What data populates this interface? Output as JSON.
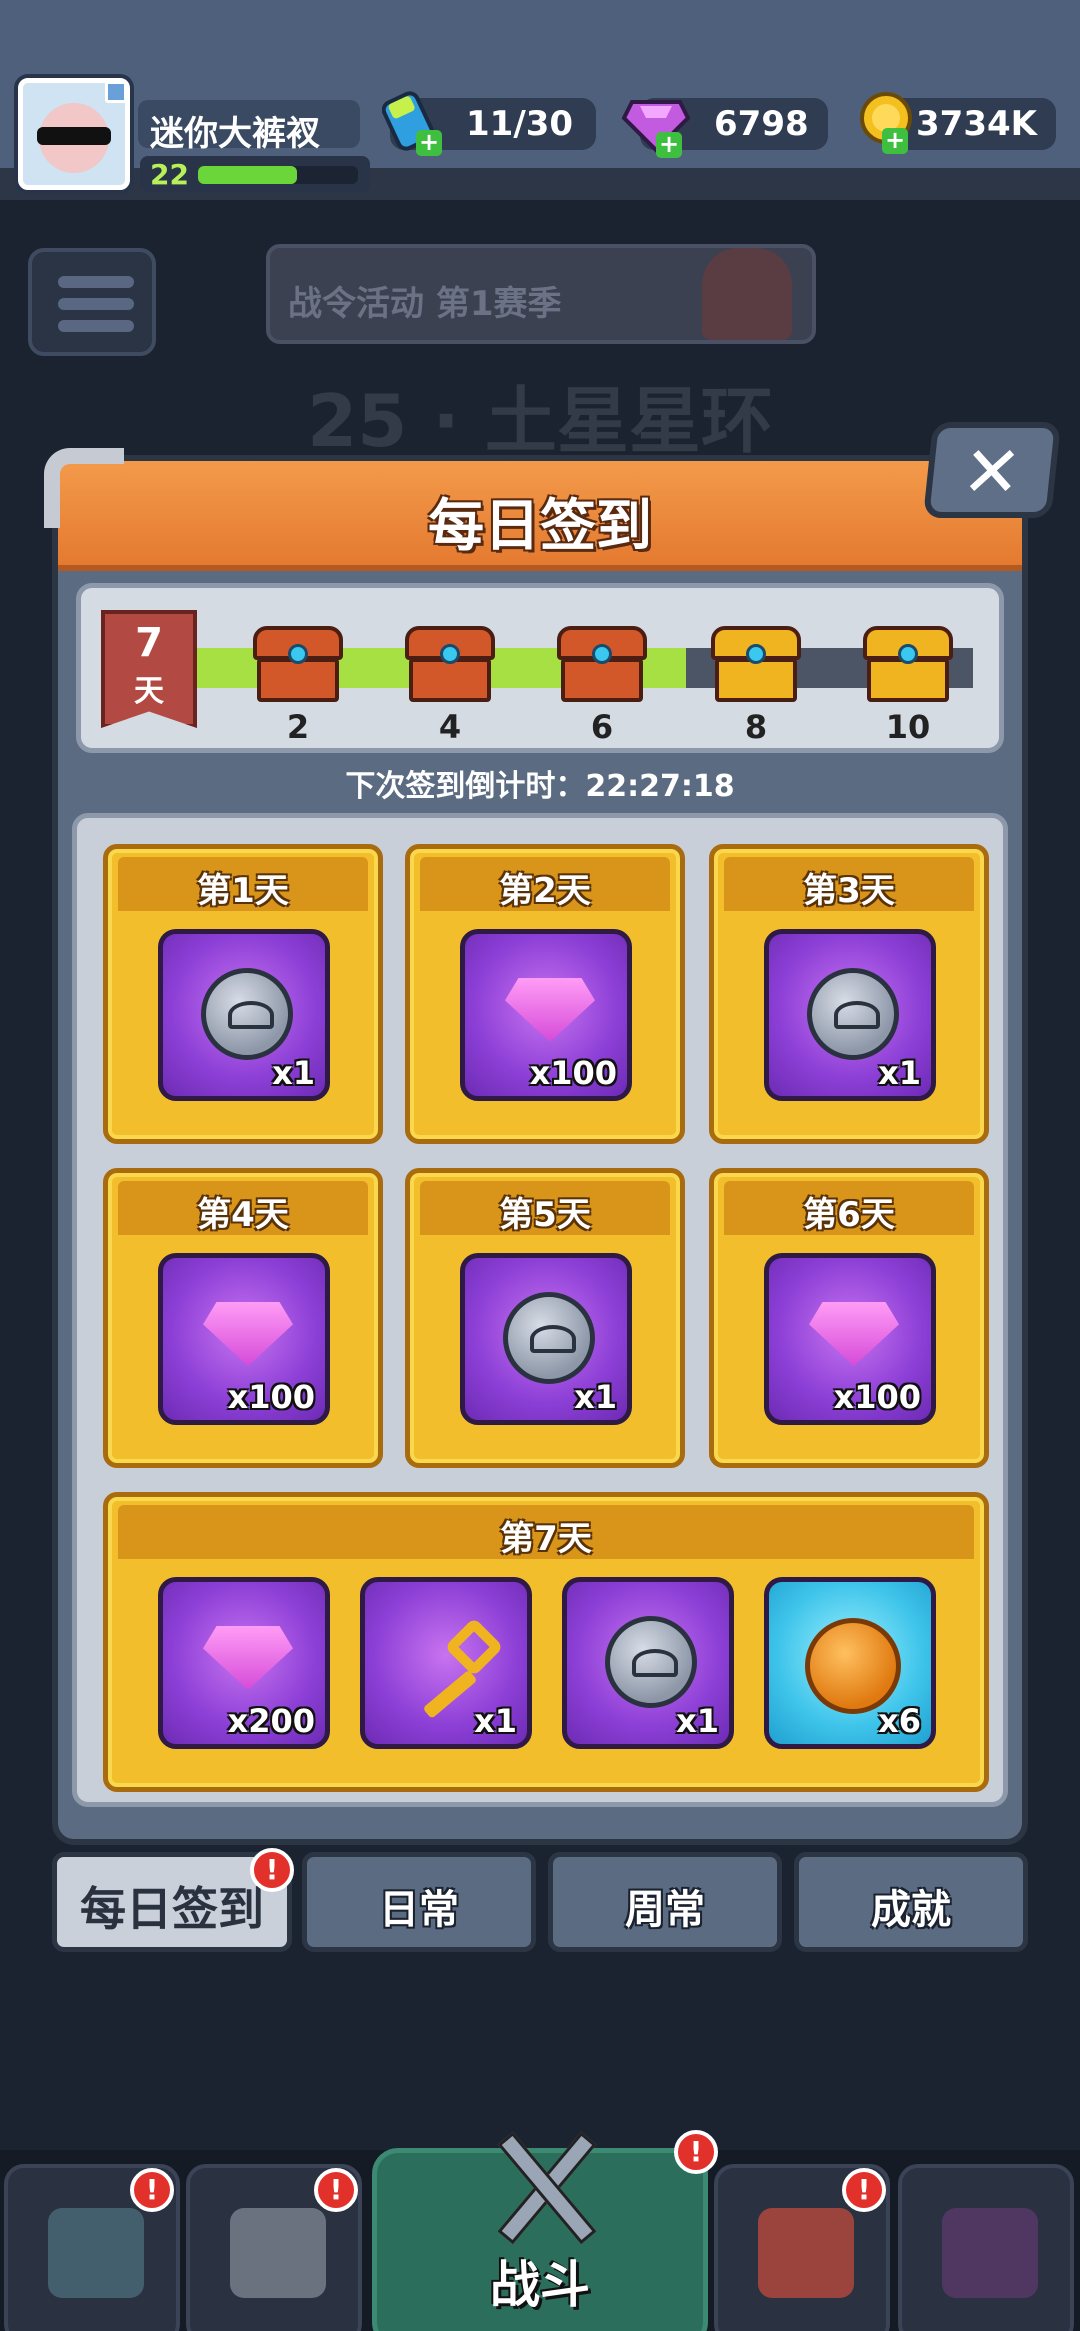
{
  "player": {
    "name": "迷你大裤衩",
    "level": "22",
    "xp_fraction": 0.62
  },
  "resources": {
    "energy": "11/30",
    "gems": "6798",
    "gold": "3734K"
  },
  "lobby": {
    "event_banner": "战令活动 第1赛季",
    "stage_title": "25 · 土星星环"
  },
  "dialog": {
    "title": "每日签到",
    "close_icon": "close-icon",
    "streak_days": "7",
    "streak_unit": "天",
    "progress_fraction": 0.632,
    "milestones": [
      {
        "label": "2",
        "type": "red-chest"
      },
      {
        "label": "4",
        "type": "red-chest"
      },
      {
        "label": "6",
        "type": "red-chest"
      },
      {
        "label": "8",
        "type": "gold-chest"
      },
      {
        "label": "10",
        "type": "gold-chest"
      }
    ],
    "countdown": "下次签到倒计时：22:27:18",
    "days": [
      {
        "title": "第1天",
        "items": [
          {
            "icon": "silver-coin-icon",
            "qty": "x1"
          }
        ]
      },
      {
        "title": "第2天",
        "items": [
          {
            "icon": "gem-icon",
            "qty": "x100"
          }
        ]
      },
      {
        "title": "第3天",
        "items": [
          {
            "icon": "silver-coin-icon",
            "qty": "x1"
          }
        ]
      },
      {
        "title": "第4天",
        "items": [
          {
            "icon": "gem-icon",
            "qty": "x100"
          }
        ]
      },
      {
        "title": "第5天",
        "items": [
          {
            "icon": "silver-coin-icon",
            "qty": "x1"
          }
        ]
      },
      {
        "title": "第6天",
        "items": [
          {
            "icon": "gem-icon",
            "qty": "x100"
          }
        ]
      },
      {
        "title": "第7天",
        "items": [
          {
            "icon": "gem-icon",
            "qty": "x200"
          },
          {
            "icon": "key-icon",
            "qty": "x1"
          },
          {
            "icon": "silver-coin-icon",
            "qty": "x1"
          },
          {
            "icon": "gold-medal-icon",
            "qty": "x6"
          }
        ]
      }
    ]
  },
  "tabs": [
    {
      "label": "每日签到",
      "active": true,
      "alert": "!"
    },
    {
      "label": "日常"
    },
    {
      "label": "周常"
    },
    {
      "label": "成就"
    }
  ],
  "bottom_nav": {
    "battle_label": "战斗",
    "alert": "!"
  },
  "colors": {
    "header_orange": "#e47a30",
    "card_gold": "#f2be2c",
    "item_purple": "#8c3fd6",
    "item_blue": "#3ec4ea",
    "progress_green": "#a6e043",
    "alert_red": "#e2302b"
  }
}
